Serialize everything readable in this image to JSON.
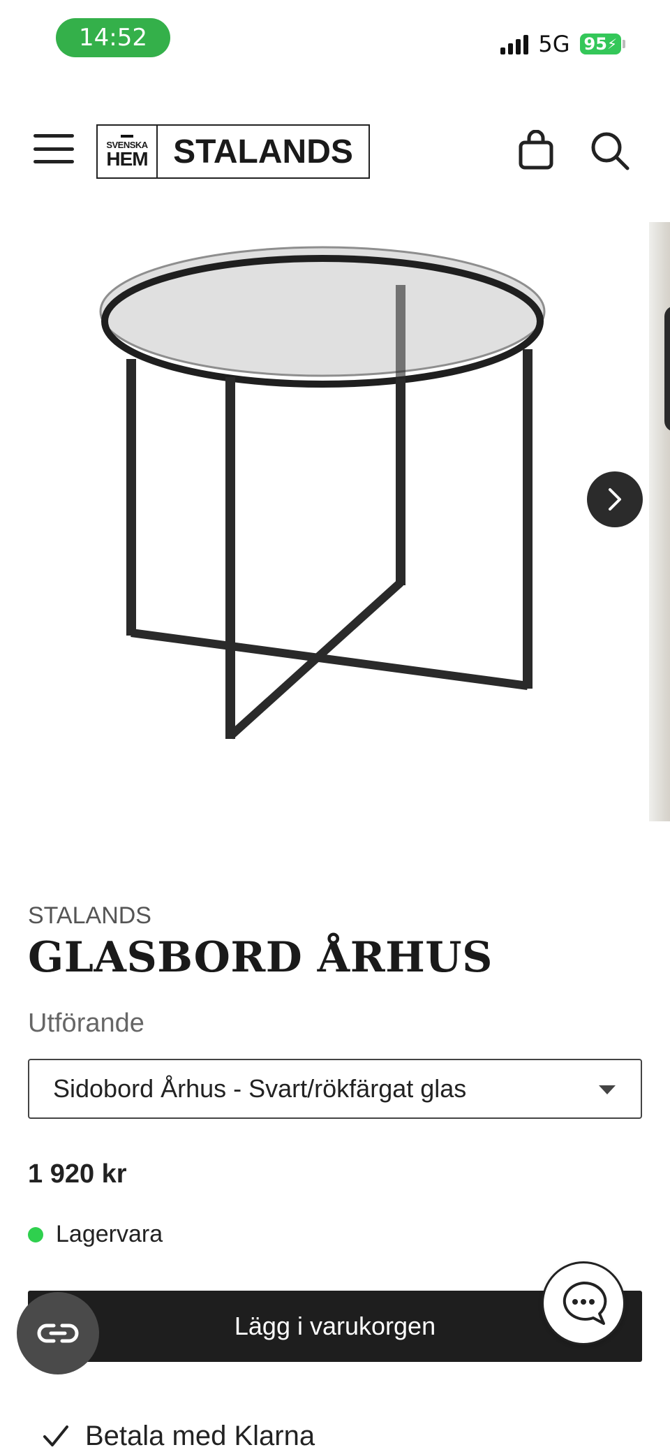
{
  "status_bar": {
    "time": "14:52",
    "network": "5G",
    "battery": "95"
  },
  "header": {
    "logo_small": "SVENSKA",
    "logo_hem": "HEM",
    "logo_main": "STALANDS"
  },
  "product": {
    "brand": "STALANDS",
    "title": "GLASBORD ÅRHUS",
    "option_label": "Utförande",
    "selected_option": "Sidobord Århus - Svart/rökfärgat glas",
    "price": "1 920 kr",
    "stock_status": "Lagervara",
    "stock_color": "#2fd04e",
    "add_to_cart": "Lägg i varukorgen",
    "payment_note": "Betala med Klarna"
  },
  "colors": {
    "accent_dark": "#1e1e1e",
    "status_green": "#34b04a"
  }
}
